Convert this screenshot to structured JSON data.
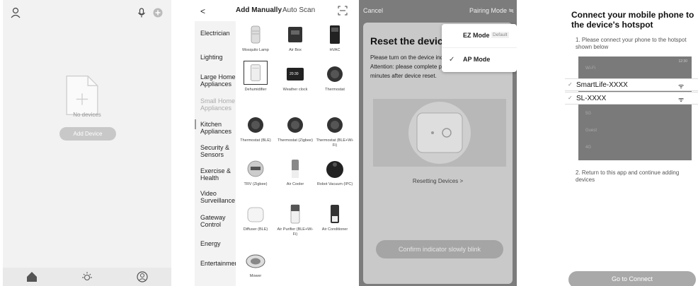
{
  "screen1": {
    "empty_text": "No devices",
    "add_device_label": "Add Device"
  },
  "screen2": {
    "back_glyph": "<",
    "tab_add_manually": "Add Manually",
    "tab_auto_scan": "Auto Scan",
    "categories": [
      "Electrician",
      "Lighting",
      "Large Home Appliances",
      "Small Home Appliances",
      "Kitchen Appliances",
      "Security & Sensors",
      "Exercise & Health",
      "Video Surveillance",
      "Gateway Control",
      "Energy",
      "Entertainment"
    ],
    "devices": [
      {
        "name": "Mosquito Lamp",
        "icon": "mosquito-lamp-icon"
      },
      {
        "name": "Air Box",
        "icon": "air-box-icon"
      },
      {
        "name": "HVAC",
        "icon": "hvac-icon"
      },
      {
        "name": "Dehumidifier",
        "icon": "dehumidifier-icon"
      },
      {
        "name": "Weather clock",
        "icon": "weather-clock-icon",
        "display": "20:30"
      },
      {
        "name": "Thermostat",
        "icon": "thermostat-icon"
      },
      {
        "name": "Thermostat (BLE)",
        "icon": "thermostat-icon"
      },
      {
        "name": "Thermostat (Zigbee)",
        "icon": "thermostat-icon"
      },
      {
        "name": "Thermostat (BLE+Wi-Fi)",
        "icon": "thermostat-icon"
      },
      {
        "name": "TRV (Zigbee)",
        "icon": "trv-icon"
      },
      {
        "name": "Air Cooler",
        "icon": "air-cooler-icon"
      },
      {
        "name": "Robot Vacuum (IPC)",
        "icon": "robot-vacuum-icon"
      },
      {
        "name": "Diffuser (BLE)",
        "icon": "diffuser-icon"
      },
      {
        "name": "Air Purifier (BLE+Wi-Fi)",
        "icon": "air-purifier-icon"
      },
      {
        "name": "Air Conditioner",
        "icon": "air-conditioner-icon"
      },
      {
        "name": "Mower",
        "icon": "mower-icon"
      }
    ]
  },
  "screen3": {
    "cancel_label": "Cancel",
    "pairing_mode_label": "Pairing Mode ≒",
    "title": "Reset the devic",
    "description": "Please turn on the device indicator is blinking slowl Attention: please complete pairing process within 3 minutes after device reset.",
    "resetting_link": "Resetting Devices >",
    "confirm_label": "Confirm indicator slowly blink",
    "menu": {
      "ez_label": "EZ Mode",
      "ez_badge": "Default",
      "ap_label": "AP Mode",
      "check_glyph": "✓"
    }
  },
  "screen4": {
    "title": "Connect your mobile phone to the device's hotspot",
    "step1": "1. Please connect your phone to the hotspot shown below",
    "wlan_header": "Wi-Fi",
    "status_time": "12:30",
    "selected_networks": [
      "SmartLife-XXXX",
      "SL-XXXX"
    ],
    "other_networks": [
      "5G",
      "Guest",
      "4G"
    ],
    "step2": "2. Return to this app and continue adding devices",
    "connect_button": "Go to Connect"
  },
  "colors": {
    "screen1_bg": "#f2f2f2",
    "overlay_gray": "#7c7c7c",
    "button_gray": "#a9a9a9"
  }
}
